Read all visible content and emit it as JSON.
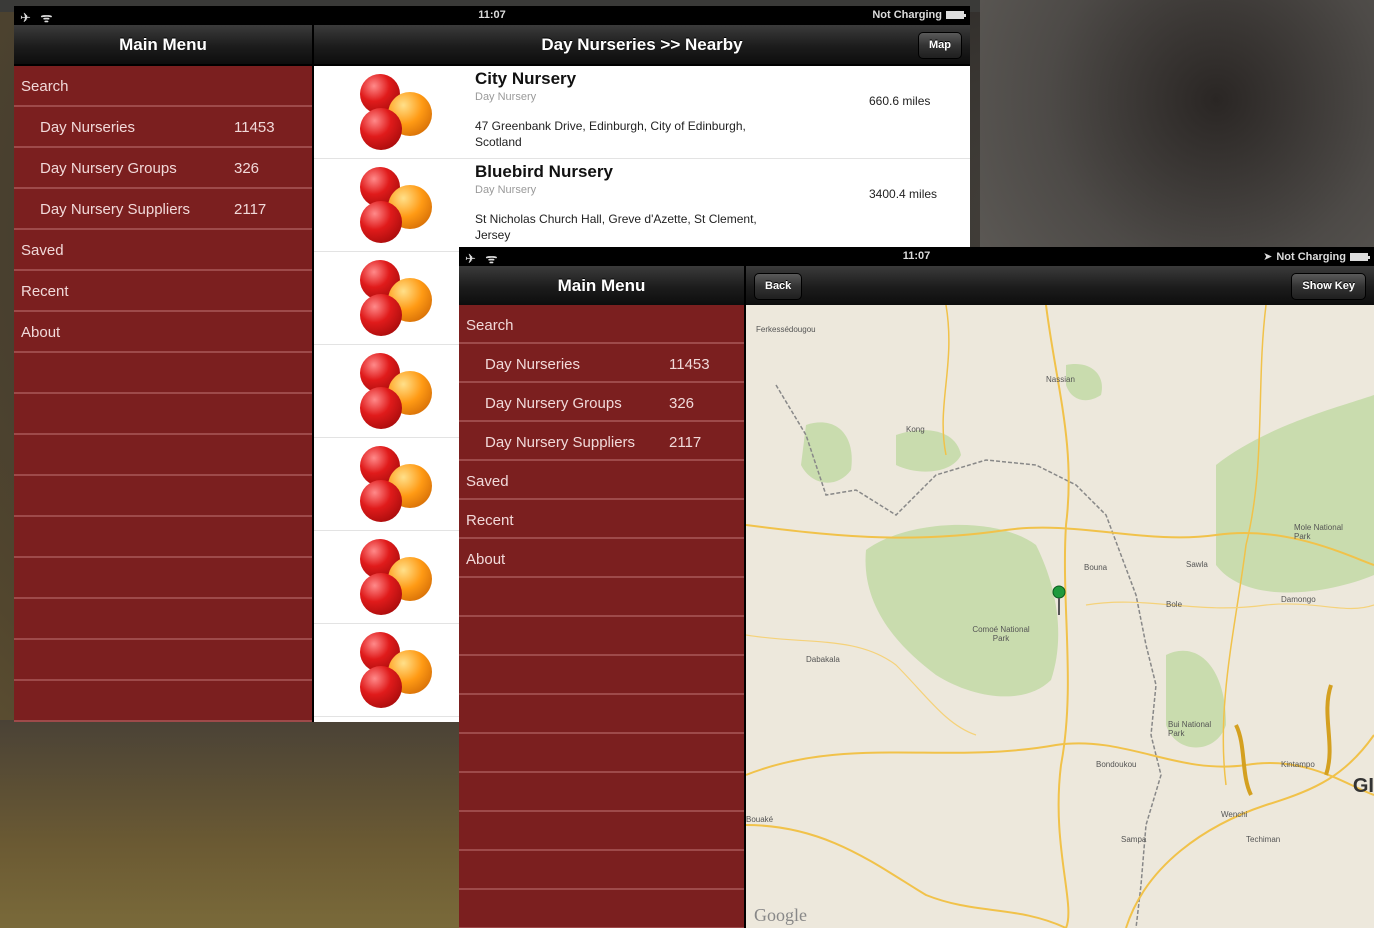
{
  "back_screen": {
    "status": {
      "time": "11:07",
      "charging": "Not Charging",
      "left_icons": "✈ ᯤ"
    },
    "sidebar_title": "Main Menu",
    "nav_title": "Day Nurseries >> Nearby",
    "map_button": "Map",
    "menu": [
      {
        "label": "Search",
        "count": "",
        "sub": false
      },
      {
        "label": "Day Nurseries",
        "count": "11453",
        "sub": true
      },
      {
        "label": "Day Nursery Groups",
        "count": "326",
        "sub": true
      },
      {
        "label": "Day Nursery Suppliers",
        "count": "2117",
        "sub": true
      },
      {
        "label": "Saved",
        "count": "",
        "sub": false
      },
      {
        "label": "Recent",
        "count": "",
        "sub": false
      },
      {
        "label": "About",
        "count": "",
        "sub": false
      }
    ],
    "nurseries": [
      {
        "name": "City Nursery",
        "type": "Day Nursery",
        "address": "47 Greenbank Drive, Edinburgh, City of Edinburgh, Scotland",
        "distance": "660.6 miles"
      },
      {
        "name": "Bluebird Nursery",
        "type": "Day Nursery",
        "address": "St Nicholas Church Hall, Greve d'Azette, St Clement, Jersey",
        "distance": "3400.4 miles"
      }
    ]
  },
  "front_screen": {
    "status": {
      "time": "11:07",
      "charging": "Not Charging",
      "left_icons": "✈ ᯤ"
    },
    "sidebar_title": "Main Menu",
    "back_button": "Back",
    "show_key_button": "Show Key",
    "menu": [
      {
        "label": "Search",
        "count": "",
        "sub": false
      },
      {
        "label": "Day Nurseries",
        "count": "11453",
        "sub": true
      },
      {
        "label": "Day Nursery Groups",
        "count": "326",
        "sub": true
      },
      {
        "label": "Day Nursery Suppliers",
        "count": "2117",
        "sub": true
      },
      {
        "label": "Saved",
        "count": "",
        "sub": false
      },
      {
        "label": "Recent",
        "count": "",
        "sub": false
      },
      {
        "label": "About",
        "count": "",
        "sub": false
      }
    ],
    "map": {
      "attribution": "Google",
      "edge_label": "GI",
      "labels": [
        {
          "text": "Bondoukou"
        },
        {
          "text": "Bouaké"
        },
        {
          "text": "Dabakala"
        },
        {
          "text": "Kong"
        },
        {
          "text": "Ferkessédougou"
        },
        {
          "text": "Comoé National Park"
        },
        {
          "text": "Sampa"
        },
        {
          "text": "Bole"
        },
        {
          "text": "Sawla"
        },
        {
          "text": "Wenchi"
        },
        {
          "text": "Techiman"
        },
        {
          "text": "Kintampo"
        },
        {
          "text": "Damongo"
        },
        {
          "text": "Bui National Park"
        },
        {
          "text": "Mole National Park"
        },
        {
          "text": "Bouna"
        },
        {
          "text": "Nassian"
        }
      ]
    }
  },
  "colors": {
    "sidebar": "#7b1f1f",
    "divider": "#9e4a4a",
    "navbar": "#1c1c1c",
    "pin": "#1e9a3c"
  }
}
